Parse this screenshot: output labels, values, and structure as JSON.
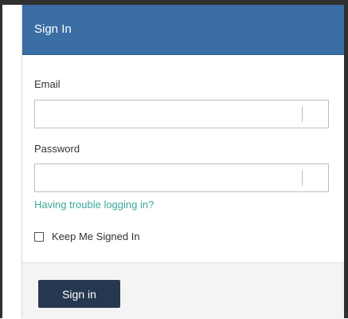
{
  "header": {
    "title": "Sign In"
  },
  "form": {
    "email_label": "Email",
    "email_value": "",
    "password_label": "Password",
    "password_value": "",
    "trouble_link": "Having trouble logging in?",
    "keep_signed_in_label": "Keep Me Signed In",
    "keep_signed_in_checked": false
  },
  "footer": {
    "signin_label": "Sign in"
  },
  "colors": {
    "header_bg": "#3a6ea5",
    "button_bg": "#26384f",
    "link": "#3aa89a",
    "footer_bg": "#f4f4f4"
  }
}
